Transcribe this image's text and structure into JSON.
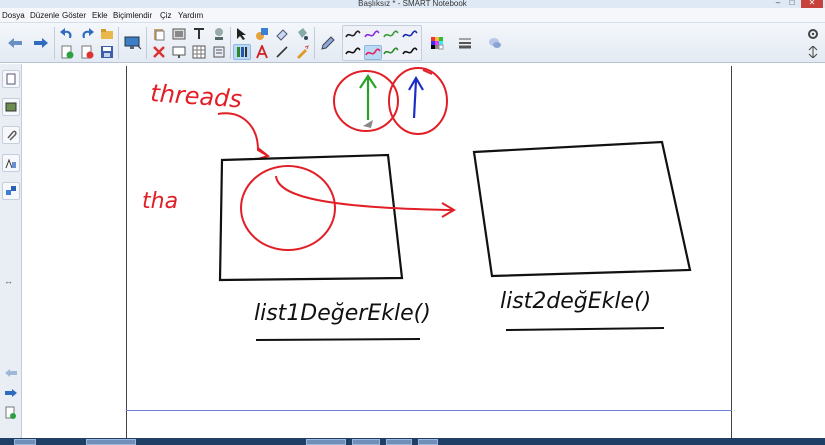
{
  "window": {
    "title": "Başlıksız * - SMART Notebook",
    "minimize_glyph": "–",
    "maximize_glyph": "□",
    "close_glyph": "✕"
  },
  "menu": {
    "items": [
      "Dosya",
      "Düzenle",
      "Göster",
      "Ekle",
      "Biçimlendir",
      "Çiz",
      "Yardım"
    ]
  },
  "toolbar": {
    "icons": [
      "back-arrow-icon",
      "forward-arrow-icon",
      "undo-icon",
      "redo-icon",
      "open-icon",
      "add-page-icon",
      "delete-icon",
      "save-icon",
      "screen-icon",
      "paste-icon",
      "table-icon",
      "screen-shade-icon",
      "document-camera-icon",
      "select-icon",
      "pen-icon",
      "shape-icon",
      "line-icon",
      "eraser-icon",
      "fill-icon",
      "text-icon",
      "creative-pen-icon",
      "color-palette-icon",
      "line-style-icon",
      "properties-icon",
      "settings-icon",
      "expand-icon"
    ],
    "pen_styles": [
      {
        "color": "#222222",
        "selected": false
      },
      {
        "color": "#8a2be2",
        "selected": false
      },
      {
        "color": "#3a9a3a",
        "selected": false
      },
      {
        "color": "#1a2ca8",
        "selected": false
      },
      {
        "color": "#111111",
        "selected": false
      },
      {
        "color": "#e0245e",
        "selected": true
      },
      {
        "color": "#2a8a2a",
        "selected": false
      },
      {
        "color": "#111111",
        "selected": false
      }
    ]
  },
  "sidebar": {
    "tabs": [
      "page-sorter-icon",
      "gallery-icon",
      "attachments-icon",
      "properties-icon",
      "addons-icon"
    ],
    "collapse_glyph": "↔"
  },
  "canvas": {
    "ink_colors": {
      "red": "#e21f26",
      "green": "#27a327",
      "blue": "#1b2fc4",
      "black": "#111111"
    },
    "labels": {
      "threads": "threads",
      "tha": "tha",
      "list1": "list1DeğerEkle()",
      "list2": "list2değEkle()"
    }
  },
  "taskbar": {
    "buttons": 6
  }
}
